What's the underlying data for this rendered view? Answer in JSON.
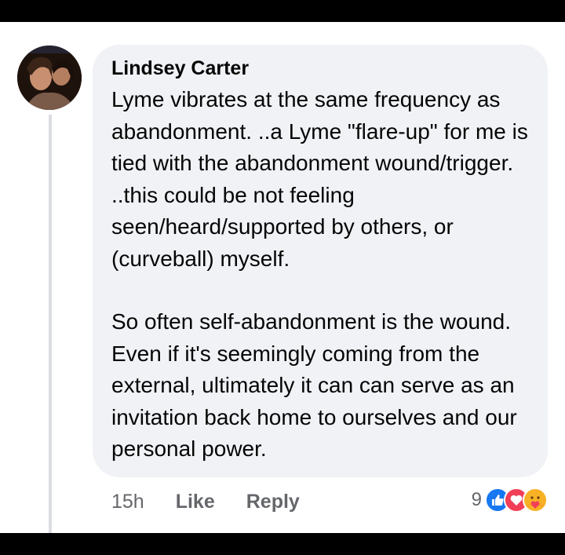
{
  "comment": {
    "author": "Lindsey Carter",
    "paragraphs": [
      "Lyme vibrates at the same frequency as abandonment. ..a Lyme \"flare-up\" for me is tied with the abandonment wound/trigger. ..this could be not feeling seen/heard/supported by others, or (curveball) myself.",
      "So often self-abandonment is the wound. Even if it's seemingly coming from the external, ultimately it can can serve as an invitation back home to ourselves and our personal power."
    ],
    "time": "15h",
    "like_label": "Like",
    "reply_label": "Reply",
    "reaction_count": "9",
    "reactions": [
      "like-icon",
      "love-icon",
      "care-icon"
    ]
  },
  "colors": {
    "bubble": "#f0f2f5",
    "like": "#1877f2",
    "love": "#f33e58",
    "care": "#f7b125"
  }
}
